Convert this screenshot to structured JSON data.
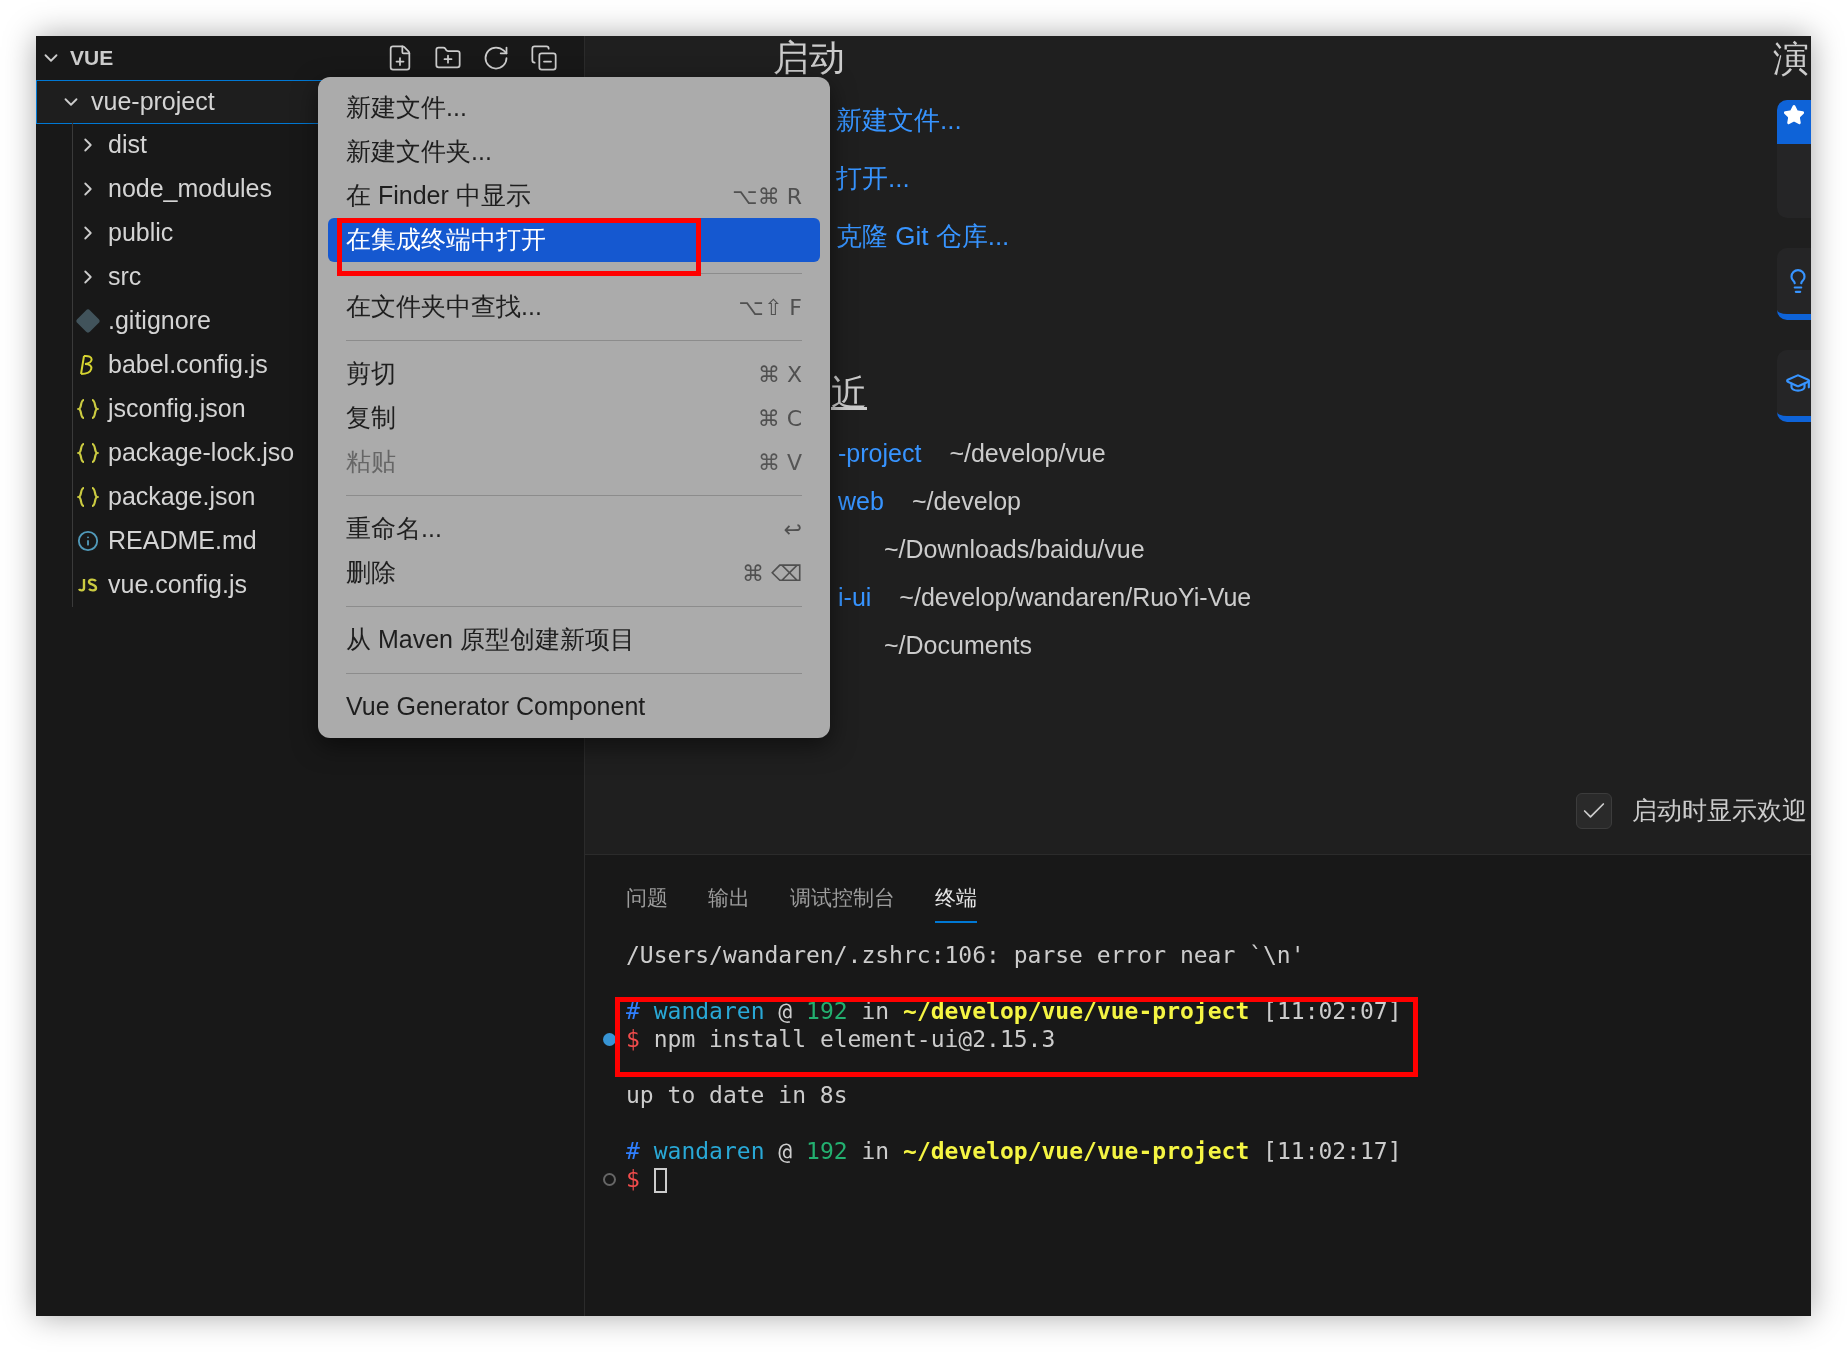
{
  "sidebar": {
    "title": "VUE",
    "tree": [
      {
        "label": "vue-project",
        "kind": "folder",
        "expanded": true,
        "selected": true,
        "children": [
          {
            "label": "dist",
            "kind": "folder",
            "expanded": false,
            "selected": false
          },
          {
            "label": "node_modules",
            "kind": "folder",
            "expanded": false,
            "selected": false
          },
          {
            "label": "public",
            "kind": "folder",
            "expanded": false,
            "selected": false
          },
          {
            "label": "src",
            "kind": "folder",
            "expanded": false,
            "selected": false
          },
          {
            "label": ".gitignore",
            "kind": "git",
            "selected": false
          },
          {
            "label": "babel.config.js",
            "kind": "babel",
            "selected": false
          },
          {
            "label": "jsconfig.json",
            "kind": "json",
            "selected": false
          },
          {
            "label": "package-lock.jso",
            "kind": "json",
            "selected": false
          },
          {
            "label": "package.json",
            "kind": "json",
            "selected": false
          },
          {
            "label": "README.md",
            "kind": "info",
            "selected": false
          },
          {
            "label": "vue.config.js",
            "kind": "js",
            "selected": false
          }
        ]
      }
    ]
  },
  "context_menu": [
    {
      "kind": "item",
      "label": "新建文件...",
      "selected": false,
      "disabled": false
    },
    {
      "kind": "item",
      "label": "新建文件夹...",
      "selected": false,
      "disabled": false
    },
    {
      "kind": "item",
      "label": "在 Finder 中显示",
      "shortcut": "⌥⌘ R",
      "selected": false,
      "disabled": false
    },
    {
      "kind": "item",
      "label": "在集成终端中打开",
      "selected": true,
      "disabled": false
    },
    {
      "kind": "separator"
    },
    {
      "kind": "item",
      "label": "在文件夹中查找...",
      "shortcut": "⌥⇧ F",
      "selected": false,
      "disabled": false
    },
    {
      "kind": "separator"
    },
    {
      "kind": "item",
      "label": "剪切",
      "shortcut": "⌘ X",
      "selected": false,
      "disabled": false
    },
    {
      "kind": "item",
      "label": "复制",
      "shortcut": "⌘ C",
      "selected": false,
      "disabled": false
    },
    {
      "kind": "item",
      "label": "粘贴",
      "shortcut": "⌘ V",
      "selected": false,
      "disabled": true
    },
    {
      "kind": "separator"
    },
    {
      "kind": "item",
      "label": "重命名...",
      "shortcut": "↩",
      "selected": false,
      "disabled": false
    },
    {
      "kind": "item",
      "label": "删除",
      "shortcut": "⌘ ⌫",
      "selected": false,
      "disabled": false
    },
    {
      "kind": "separator"
    },
    {
      "kind": "item",
      "label": "从 Maven 原型创建新项目",
      "selected": false,
      "disabled": false
    },
    {
      "kind": "separator"
    },
    {
      "kind": "item",
      "label": "Vue Generator Component",
      "selected": false,
      "disabled": false
    }
  ],
  "welcome": {
    "start_heading": "启动",
    "start_links": [
      "新建文件...",
      "打开...",
      "克隆 Git 仓库..."
    ],
    "recent_heading": "近",
    "recent": [
      {
        "name": "-project",
        "path": "~/develop/vue"
      },
      {
        "name": "web",
        "path": "~/develop"
      },
      {
        "path": "~/Downloads/baidu/vue"
      },
      {
        "name": "i-ui",
        "path": "~/develop/wandaren/RuoYi-Vue"
      },
      {
        "path": "~/Documents"
      }
    ],
    "walkthrough_heading": "演",
    "show_on_startup": {
      "label": "启动时显示欢迎",
      "checked": true
    }
  },
  "panel": {
    "tabs": [
      {
        "label": "问题",
        "selected": false
      },
      {
        "label": "输出",
        "selected": false
      },
      {
        "label": "调试控制台",
        "selected": false
      },
      {
        "label": "终端",
        "selected": true
      }
    ],
    "terminal": [
      {
        "segments": [
          {
            "kind": "plain",
            "text": "/Users/wandaren/.zshrc:106: parse error near `\\n'"
          }
        ]
      },
      {
        "kind": "blank"
      },
      {
        "segments": [
          {
            "kind": "hash",
            "text": "#"
          },
          {
            "kind": "user",
            "text": "wandaren"
          },
          {
            "kind": "plain",
            "text": "@"
          },
          {
            "kind": "host",
            "text": "192"
          },
          {
            "kind": "plain",
            "text": "in"
          },
          {
            "kind": "path",
            "text": "~/develop/vue/vue-project"
          },
          {
            "kind": "plain",
            "text": "[11:02:07]"
          }
        ]
      },
      {
        "finished": true,
        "segments": [
          {
            "kind": "dollar",
            "text": "$"
          },
          {
            "kind": "plain",
            "text": "npm install element-ui@2.15.3"
          }
        ]
      },
      {
        "kind": "blank"
      },
      {
        "segments": [
          {
            "kind": "plain",
            "text": "up to date in 8s"
          }
        ]
      },
      {
        "kind": "blank"
      },
      {
        "segments": [
          {
            "kind": "hash",
            "text": "#"
          },
          {
            "kind": "user",
            "text": "wandaren"
          },
          {
            "kind": "plain",
            "text": "@"
          },
          {
            "kind": "host",
            "text": "192"
          },
          {
            "kind": "plain",
            "text": "in"
          },
          {
            "kind": "path",
            "text": "~/develop/vue/vue-project"
          },
          {
            "kind": "plain",
            "text": "[11:02:17]"
          }
        ]
      },
      {
        "finished": false,
        "cursor": true,
        "segments": [
          {
            "kind": "dollar",
            "text": "$"
          }
        ]
      }
    ]
  }
}
